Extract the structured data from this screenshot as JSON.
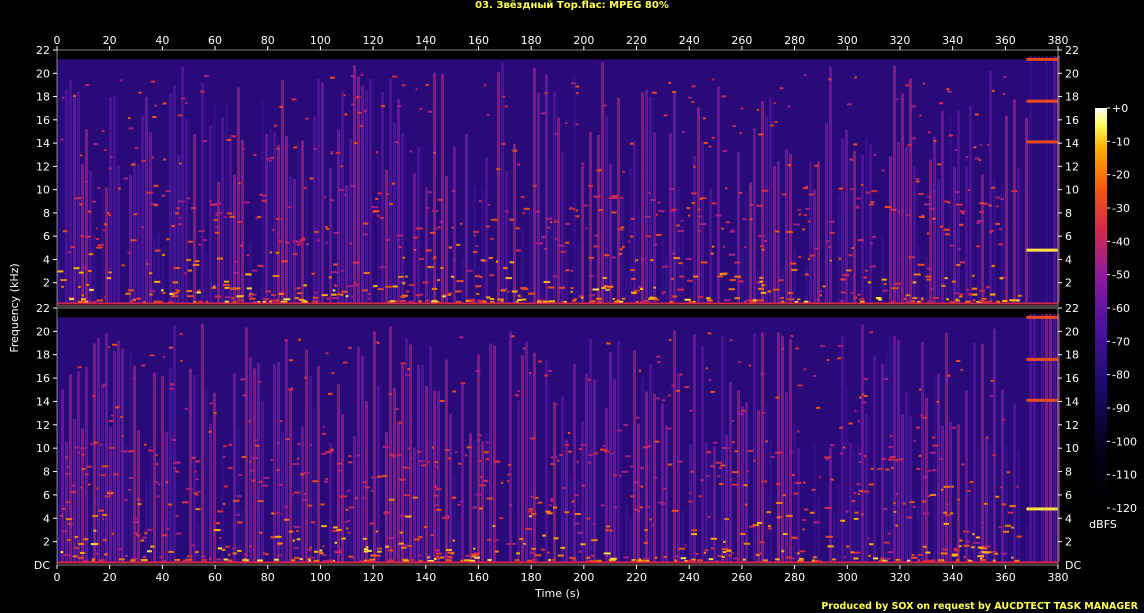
{
  "title": "03. Звёздный Тор.flac: MPEG 80%",
  "credit": "Produced by SOX on request by AUCDTECT TASK MANAGER",
  "chart_data": {
    "type": "heatmap",
    "xlabel": "Time (s)",
    "ylabel": "Frequency (kHz)",
    "x_ticks": [
      "0",
      "20",
      "40",
      "60",
      "80",
      "100",
      "120",
      "140",
      "160",
      "180",
      "200",
      "220",
      "240",
      "260",
      "280",
      "300",
      "320",
      "340",
      "360",
      "380"
    ],
    "x_ticks_upper": [
      "0",
      "20",
      "40",
      "60",
      "80",
      "100",
      "120",
      "140",
      "160",
      "180",
      "200",
      "220",
      "240",
      "260",
      "280",
      "300",
      "320",
      "340",
      "360",
      "380"
    ],
    "xlim": [
      0,
      380
    ],
    "y_ticks": [
      "22",
      "20",
      "18",
      "16",
      "14",
      "12",
      "10",
      "8",
      "6",
      "4",
      "2"
    ],
    "y_bottom_label": "DC",
    "ylim_khz": [
      0,
      22
    ],
    "channels": 2,
    "cutoff_khz": 21.2,
    "colorbar": {
      "label": "dBFS",
      "ticks": [
        "+0",
        "-10",
        "-20",
        "-30",
        "-40",
        "-50",
        "-60",
        "-70",
        "-80",
        "-90",
        "-100",
        "-110",
        "-120"
      ],
      "range_db": [
        -120,
        0
      ]
    }
  },
  "colors": {
    "title": "#ffff55",
    "background": "#000000",
    "text": "#ffffff"
  }
}
